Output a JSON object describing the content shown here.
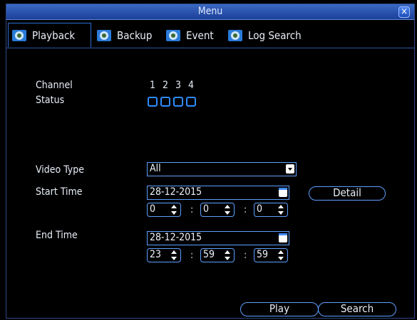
{
  "window": {
    "title": "Menu",
    "close": "×"
  },
  "tabs": [
    {
      "label": "Playback",
      "active": true
    },
    {
      "label": "Backup",
      "active": false
    },
    {
      "label": "Event",
      "active": false
    },
    {
      "label": "Log Search",
      "active": false
    }
  ],
  "channels": {
    "channel_label": "Channel",
    "status_label": "Status",
    "numbers": [
      "1",
      "2",
      "3",
      "4"
    ],
    "checked": [
      false,
      false,
      false,
      false
    ]
  },
  "video_type": {
    "label": "Video Type",
    "value": "All"
  },
  "start_time": {
    "label": "Start Time",
    "date": "28-12-2015",
    "hour": "0",
    "minute": "0",
    "second": "0",
    "detail_label": "Detail"
  },
  "end_time": {
    "label": "End Time",
    "date": "28-12-2015",
    "hour": "23",
    "minute": "59",
    "second": "59"
  },
  "separator": ":",
  "buttons": {
    "play": "Play",
    "search": "Search"
  },
  "colors": {
    "accent": "#2f8cff",
    "titlebar": "#2b56b0",
    "background": "#000000"
  }
}
